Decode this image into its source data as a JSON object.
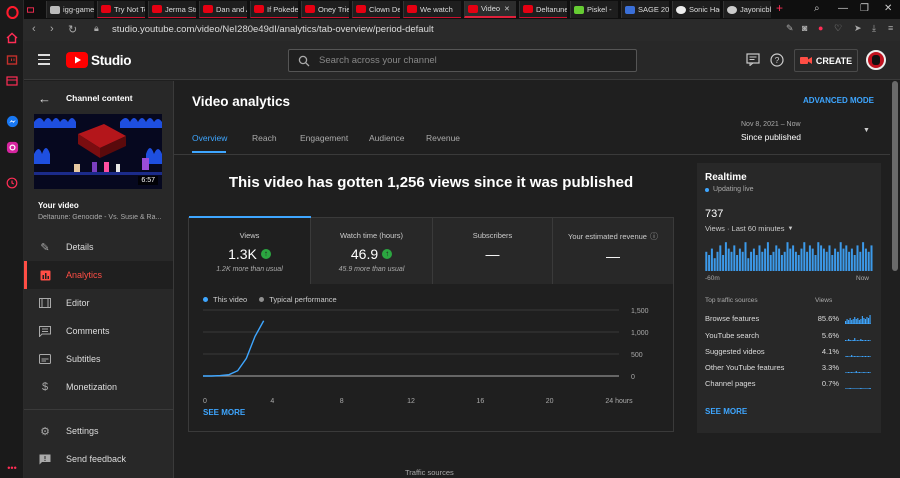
{
  "browser": {
    "tabs": [
      {
        "label": "igg-games"
      },
      {
        "label": "Try Not To"
      },
      {
        "label": "Jerma Stre"
      },
      {
        "label": "Dan and A"
      },
      {
        "label": "If Pokede"
      },
      {
        "label": "Oney Trie"
      },
      {
        "label": "Clown De"
      },
      {
        "label": "We watch"
      },
      {
        "label": "Video"
      },
      {
        "label": "Deltarune"
      },
      {
        "label": "Piskel -"
      },
      {
        "label": "SAGE 202"
      },
      {
        "label": "Sonic Hac"
      },
      {
        "label": "Jayonicbl"
      }
    ],
    "url": "studio.youtube.com/video/NeI280e49dI/analytics/tab-overview/period-default",
    "colors": {
      "accent": "#e0203a"
    }
  },
  "header": {
    "logo_label": "Studio",
    "search_placeholder": "Search across your channel",
    "create_label": "CREATE"
  },
  "sidebar": {
    "back_label": "Channel content",
    "thumbnail_duration": "6:57",
    "your_video_label": "Your video",
    "video_title": "Deltarune: Genocide - Vs. Susie & Ra...",
    "items": [
      {
        "label": "Details",
        "icon": "pencil-icon"
      },
      {
        "label": "Analytics",
        "icon": "analytics-icon"
      },
      {
        "label": "Editor",
        "icon": "film-icon"
      },
      {
        "label": "Comments",
        "icon": "comment-icon"
      },
      {
        "label": "Subtitles",
        "icon": "subtitles-icon"
      },
      {
        "label": "Monetization",
        "icon": "dollar-icon"
      },
      {
        "label": "Settings",
        "icon": "gear-icon"
      },
      {
        "label": "Send feedback",
        "icon": "feedback-icon"
      }
    ]
  },
  "main": {
    "page_title": "Video analytics",
    "advanced_mode": "ADVANCED MODE",
    "tabs": [
      "Overview",
      "Reach",
      "Engagement",
      "Audience",
      "Revenue"
    ],
    "period": {
      "range": "Nov 8, 2021 – Now",
      "label": "Since published"
    },
    "headline": "This video has gotten 1,256 views since it was published",
    "metrics": [
      {
        "label": "Views",
        "value": "1.3K",
        "sub": "1.2K more than usual",
        "trend": "up"
      },
      {
        "label": "Watch time (hours)",
        "value": "46.9",
        "sub": "45.9 more than usual",
        "trend": "up"
      },
      {
        "label": "Subscribers",
        "value": "—",
        "sub": ""
      },
      {
        "label": "Your estimated revenue",
        "value": "—",
        "sub": ""
      }
    ],
    "legend": {
      "this_video": "This video",
      "typical": "Typical performance"
    },
    "see_more": "SEE MORE",
    "traffic_sources_label": "Traffic sources"
  },
  "chart_data": {
    "type": "line",
    "x": [
      0,
      0.5,
      1,
      1.5,
      2,
      2.5,
      3,
      3.5
    ],
    "series": [
      {
        "name": "This video",
        "values": [
          0,
          0,
          10,
          30,
          120,
          400,
          900,
          1256
        ]
      },
      {
        "name": "Typical performance",
        "values": [
          0,
          0,
          0,
          0,
          0,
          0,
          0,
          0
        ]
      }
    ],
    "xticks": [
      "0",
      "4",
      "8",
      "12",
      "16",
      "20",
      "24 hours"
    ],
    "yticks": [
      "0",
      "500",
      "1,000",
      "1,500"
    ],
    "xlim": [
      0,
      24
    ],
    "ylim": [
      0,
      1500
    ],
    "colors": {
      "this_video": "#3ea6ff",
      "typical": "#909090"
    }
  },
  "realtime": {
    "title": "Realtime",
    "status": "Updating live",
    "count": "737",
    "period": "Views · Last 60 minutes",
    "axis_start": "-60m",
    "axis_end": "Now",
    "bars": [
      6,
      5,
      7,
      4,
      6,
      8,
      5,
      9,
      7,
      6,
      8,
      5,
      7,
      6,
      9,
      4,
      6,
      7,
      5,
      8,
      6,
      7,
      9,
      5,
      6,
      8,
      7,
      5,
      6,
      9,
      7,
      8,
      6,
      5,
      7,
      9,
      6,
      8,
      7,
      5,
      9,
      8,
      7,
      6,
      8,
      5,
      7,
      6,
      9,
      7,
      8,
      6,
      7,
      5,
      8,
      6,
      9,
      7,
      6,
      8
    ],
    "top_sources_label": "Top traffic sources",
    "views_label": "Views",
    "sources": [
      {
        "name": "Browse features",
        "pct": "85.6%"
      },
      {
        "name": "YouTube search",
        "pct": "5.6%"
      },
      {
        "name": "Suggested videos",
        "pct": "4.1%"
      },
      {
        "name": "Other YouTube features",
        "pct": "3.3%"
      },
      {
        "name": "Channel pages",
        "pct": "0.7%"
      }
    ],
    "see_more": "SEE MORE"
  }
}
